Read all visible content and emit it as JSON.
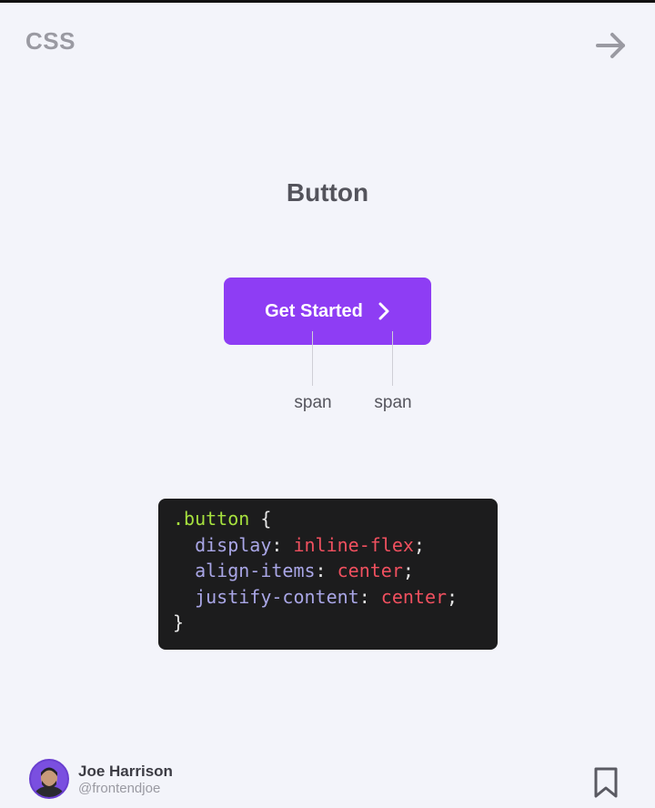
{
  "header": {
    "tag": "CSS",
    "next_icon": "arrow-right-icon"
  },
  "main": {
    "title": "Button",
    "demo_button": {
      "label": "Get Started",
      "icon": "chevron-right-icon",
      "color": "#8e3df4"
    },
    "annotations": [
      "span",
      "span"
    ]
  },
  "code": {
    "lines": [
      [
        {
          "t": ".button",
          "c": "sel"
        },
        {
          "t": " {",
          "c": "punc"
        }
      ],
      [
        {
          "t": "  display",
          "c": "prop"
        },
        {
          "t": ": ",
          "c": "punc"
        },
        {
          "t": "inline-flex",
          "c": "val"
        },
        {
          "t": ";",
          "c": "punc"
        }
      ],
      [
        {
          "t": "  align-items",
          "c": "prop"
        },
        {
          "t": ": ",
          "c": "punc"
        },
        {
          "t": "center",
          "c": "val"
        },
        {
          "t": ";",
          "c": "punc"
        }
      ],
      [
        {
          "t": "  justify-content",
          "c": "prop"
        },
        {
          "t": ": ",
          "c": "punc"
        },
        {
          "t": "center",
          "c": "val"
        },
        {
          "t": ";",
          "c": "punc"
        }
      ],
      [
        {
          "t": "}",
          "c": "punc"
        }
      ]
    ],
    "colors": {
      "background": "#1c1c1d",
      "selector": "#a6e03e",
      "property": "#a9a6e6",
      "value": "#f0505f"
    }
  },
  "footer": {
    "author_name": "Joe Harrison",
    "author_handle": "@frontendjoe",
    "bookmark_icon": "bookmark-icon"
  }
}
